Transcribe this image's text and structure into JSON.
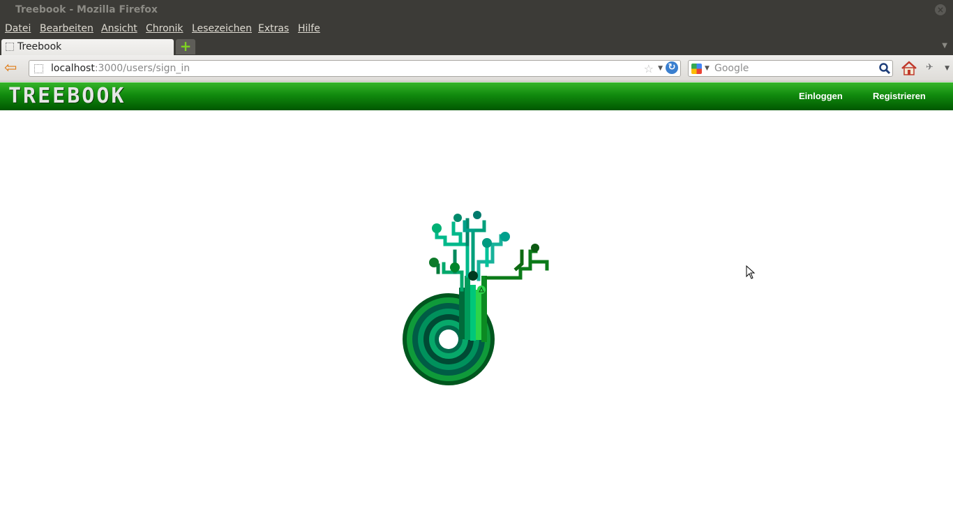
{
  "window": {
    "title": "Treebook - Mozilla Firefox",
    "close_symbol": "×"
  },
  "menu": [
    "Datei",
    "Bearbeiten",
    "Ansicht",
    "Chronik",
    "Lesezeichen",
    "Extras",
    "Hilfe"
  ],
  "tab": {
    "label": "Treebook",
    "new_tab_symbol": "+"
  },
  "urlbar": {
    "host": "localhost",
    "path": ":3000/users/sign_in"
  },
  "search": {
    "placeholder": "Google"
  },
  "app": {
    "brand": "TREEBOOK",
    "nav": {
      "login": "Einloggen",
      "register": "Registrieren"
    }
  },
  "colors": {
    "header_top": "#36b52a",
    "header_bottom": "#005700",
    "logo_dark": "#005f36",
    "logo_light": "#00c285"
  }
}
